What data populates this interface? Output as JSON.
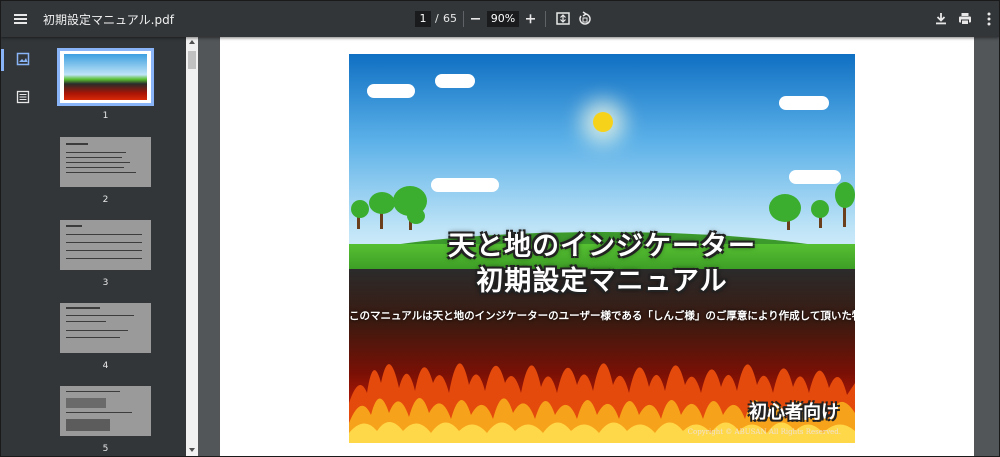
{
  "toolbar": {
    "title": "初期設定マニュアル.pdf",
    "current_page": "1",
    "separator": "/",
    "total_pages": "65",
    "zoom": "90%",
    "icons": [
      "menu-icon",
      "zoom-out-icon",
      "zoom-in-icon",
      "fit-page-icon",
      "rotate-icon",
      "download-icon",
      "print-icon",
      "more-icon"
    ]
  },
  "sidebar": {
    "icons": [
      "thumbnails-icon",
      "outline-icon"
    ],
    "thumbnails": [
      {
        "label": "1"
      },
      {
        "label": "2"
      },
      {
        "label": "3"
      },
      {
        "label": "4"
      },
      {
        "label": "5"
      }
    ]
  },
  "cover": {
    "title_line1": "天と地のインジケーター",
    "title_line2": "初期設定マニュアル",
    "subtitle": "このマニュアルは天と地のインジケーターのユーザー様である「しんご様」のご厚意により作成して頂いた物です。",
    "badge": "初心者向け",
    "copyright": "Copyright © ABUSAN All Rights Reserved.",
    "colors": {
      "sky": "#5ab0e8",
      "grass": "#56c032",
      "fire": "#d92a08",
      "sun": "#f7d21b"
    }
  }
}
